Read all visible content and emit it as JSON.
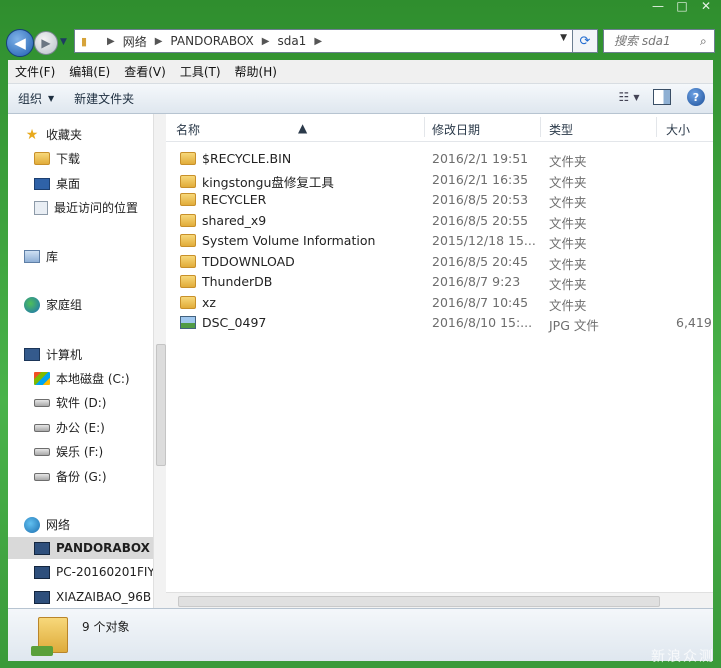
{
  "window": {
    "controls": [
      "—",
      "□",
      "✕"
    ]
  },
  "address": {
    "crumbs": [
      "网络",
      "PANDORABOX",
      "sda1"
    ],
    "search_placeholder": "搜索 sda1"
  },
  "menu": [
    "文件(F)",
    "编辑(E)",
    "查看(V)",
    "工具(T)",
    "帮助(H)"
  ],
  "toolbar": {
    "organize": "组织",
    "new_folder": "新建文件夹"
  },
  "nav": {
    "favorites": "收藏夹",
    "downloads": "下载",
    "desktop": "桌面",
    "recent": "最近访问的位置",
    "libraries": "库",
    "homegroup": "家庭组",
    "computer": "计算机",
    "drives": [
      "本地磁盘 (C:)",
      "软件 (D:)",
      "办公 (E:)",
      "娱乐 (F:)",
      "备份 (G:)"
    ],
    "network": "网络",
    "net_items": [
      "PANDORABOX",
      "PC-20160201FIY",
      "XIAZAIBAO_96B"
    ]
  },
  "columns": {
    "name": "名称",
    "date": "修改日期",
    "type": "类型",
    "size": "大小"
  },
  "files": [
    {
      "name": "$RECYCLE.BIN",
      "date": "2016/2/1 19:51",
      "type": "文件夹",
      "size": "",
      "icon": "folder-icon"
    },
    {
      "name": "kingstongu盘修复工具",
      "date": "2016/2/1 16:35",
      "type": "文件夹",
      "size": "",
      "icon": "folder-icon"
    },
    {
      "name": "RECYCLER",
      "date": "2016/8/5 20:53",
      "type": "文件夹",
      "size": "",
      "icon": "folder-icon"
    },
    {
      "name": "shared_x9",
      "date": "2016/8/5 20:55",
      "type": "文件夹",
      "size": "",
      "icon": "folder-icon"
    },
    {
      "name": "System Volume Information",
      "date": "2015/12/18 15...",
      "type": "文件夹",
      "size": "",
      "icon": "folder-icon"
    },
    {
      "name": "TDDOWNLOAD",
      "date": "2016/8/5 20:45",
      "type": "文件夹",
      "size": "",
      "icon": "folder-icon"
    },
    {
      "name": "ThunderDB",
      "date": "2016/8/7 9:23",
      "type": "文件夹",
      "size": "",
      "icon": "folder-icon"
    },
    {
      "name": "xz",
      "date": "2016/8/7 10:45",
      "type": "文件夹",
      "size": "",
      "icon": "folder-icon"
    },
    {
      "name": "DSC_0497",
      "date": "2016/8/10 15:...",
      "type": "JPG 文件",
      "size": "6,419",
      "icon": "image-file-icon"
    }
  ],
  "status": {
    "count": "9 个对象"
  },
  "watermark": "新浪众测"
}
